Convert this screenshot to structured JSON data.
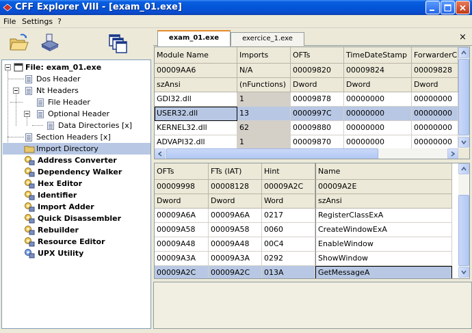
{
  "window": {
    "title": "CFF Explorer VIII - [exam_01.exe]"
  },
  "menu": [
    "File",
    "Settings",
    "?"
  ],
  "toolbar": {
    "icons": [
      "open-folder-icon",
      "save-disk-icon",
      "windows-icon"
    ]
  },
  "tree": {
    "root": "File: exam_01.exe",
    "items": [
      "Dos Header",
      "Nt Headers",
      "File Header",
      "Optional Header",
      "Data Directories [x]",
      "Section Headers [x]",
      "Import Directory",
      "Address Converter",
      "Dependency Walker",
      "Hex Editor",
      "Identifier",
      "Import Adder",
      "Quick Disassembler",
      "Rebuilder",
      "Resource Editor",
      "UPX Utility"
    ],
    "selected": "Import Directory"
  },
  "tabs": [
    "exam_01.exe",
    "exercice_1.exe"
  ],
  "tab_close": "×",
  "modules_table": {
    "columns": [
      "Module Name",
      "Imports",
      "OFTs",
      "TimeDateStamp",
      "ForwarderCh"
    ],
    "offsets": [
      "00009AA6",
      "N/A",
      "00009820",
      "00009824",
      "00009828"
    ],
    "types": [
      "szAnsi",
      "(nFunctions)",
      "Dword",
      "Dword",
      "Dword"
    ],
    "rows": [
      [
        "GDI32.dll",
        "1",
        "00009878",
        "00000000",
        "00000000"
      ],
      [
        "USER32.dll",
        "13",
        "0000997C",
        "00000000",
        "00000000"
      ],
      [
        "KERNEL32.dll",
        "62",
        "00009880",
        "00000000",
        "00000000"
      ],
      [
        "ADVAPI32.dll",
        "1",
        "00009870",
        "00000000",
        "00000000"
      ]
    ],
    "selected_row": 1
  },
  "imports_table": {
    "columns": [
      "OFTs",
      "FTs (IAT)",
      "Hint",
      "Name"
    ],
    "offsets": [
      "00009998",
      "00008128",
      "00009A2C",
      "00009A2E"
    ],
    "types": [
      "Dword",
      "Dword",
      "Word",
      "szAnsi"
    ],
    "rows": [
      [
        "00009A6A",
        "00009A6A",
        "0217",
        "RegisterClassExA"
      ],
      [
        "00009A58",
        "00009A58",
        "0060",
        "CreateWindowExA"
      ],
      [
        "00009A48",
        "00009A48",
        "00C4",
        "EnableWindow"
      ],
      [
        "00009A3A",
        "00009A3A",
        "0292",
        "ShowWindow"
      ],
      [
        "00009A2C",
        "00009A2C",
        "013A",
        "GetMessageA"
      ]
    ],
    "selected_row": 4
  },
  "colors": {
    "titlebar": "#0355d8",
    "selection": "#b8c8e4",
    "active_tab_accent": "#e68b2c"
  }
}
